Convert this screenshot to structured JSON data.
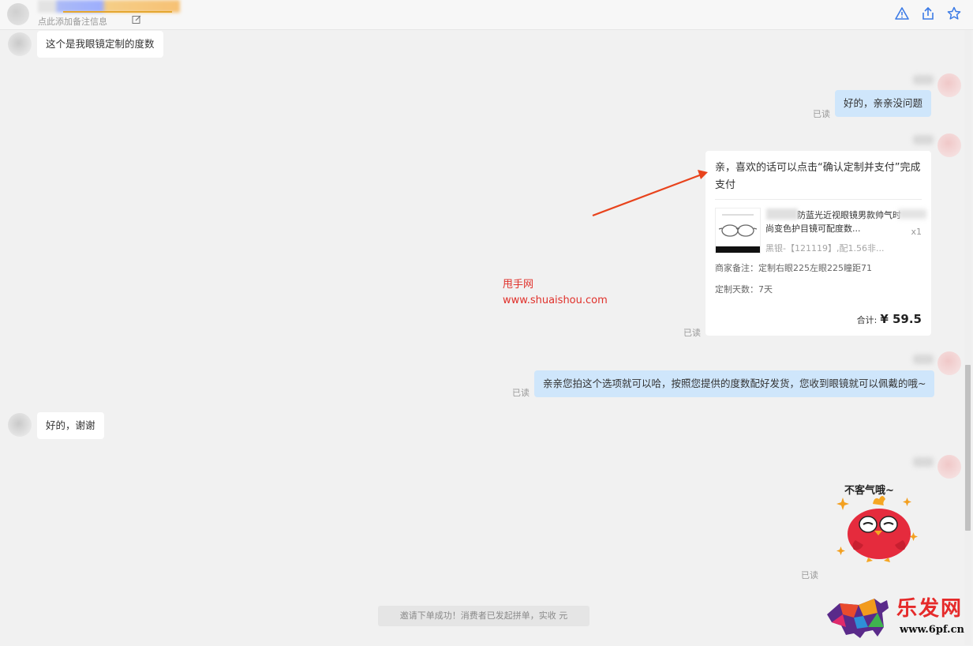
{
  "header": {
    "remark_placeholder": "点此添加备注信息",
    "icons": [
      "alert-icon",
      "share-icon",
      "star-icon"
    ]
  },
  "messages": {
    "m1_text": "这个是我眼镜定制的度数",
    "m2_text": "好的，亲亲没问题",
    "m2_read": "已读",
    "card": {
      "text": "亲，喜欢的话可以点击“确认定制并支付”完成支付",
      "product_title": "防蓝光近视眼镜男款帅气时尚变色护目镜可配度数...",
      "sku": "黑银-【121119】,配1.56非...",
      "qty": "x1",
      "remark": "商家备注：定制右眼225左眼225瞳距71",
      "days": "定制天数：7天",
      "total_label": "合计:",
      "total_price": "¥ 59.5",
      "read": "已读"
    },
    "m4_text": "亲亲您拍这个选项就可以哈，按照您提供的度数配好发货，您收到眼镜就可以佩戴的哦~",
    "m4_read": "已读",
    "m5_text": "好的，谢谢",
    "sticker_text": "不客气哦~",
    "sticker_read": "已读",
    "system_notice": "邀请下单成功！消费者已发起拼单，实收    元"
  },
  "watermark": {
    "line1": "甩手网",
    "line2": "www.shuaishou.com"
  },
  "logo": {
    "text_cn": "乐发网",
    "text_url": "www.6pf.cn"
  },
  "colors": {
    "blue_bubble": "#cfe6fb",
    "arrow": "#e8431c",
    "watermark": "#e0302a"
  }
}
